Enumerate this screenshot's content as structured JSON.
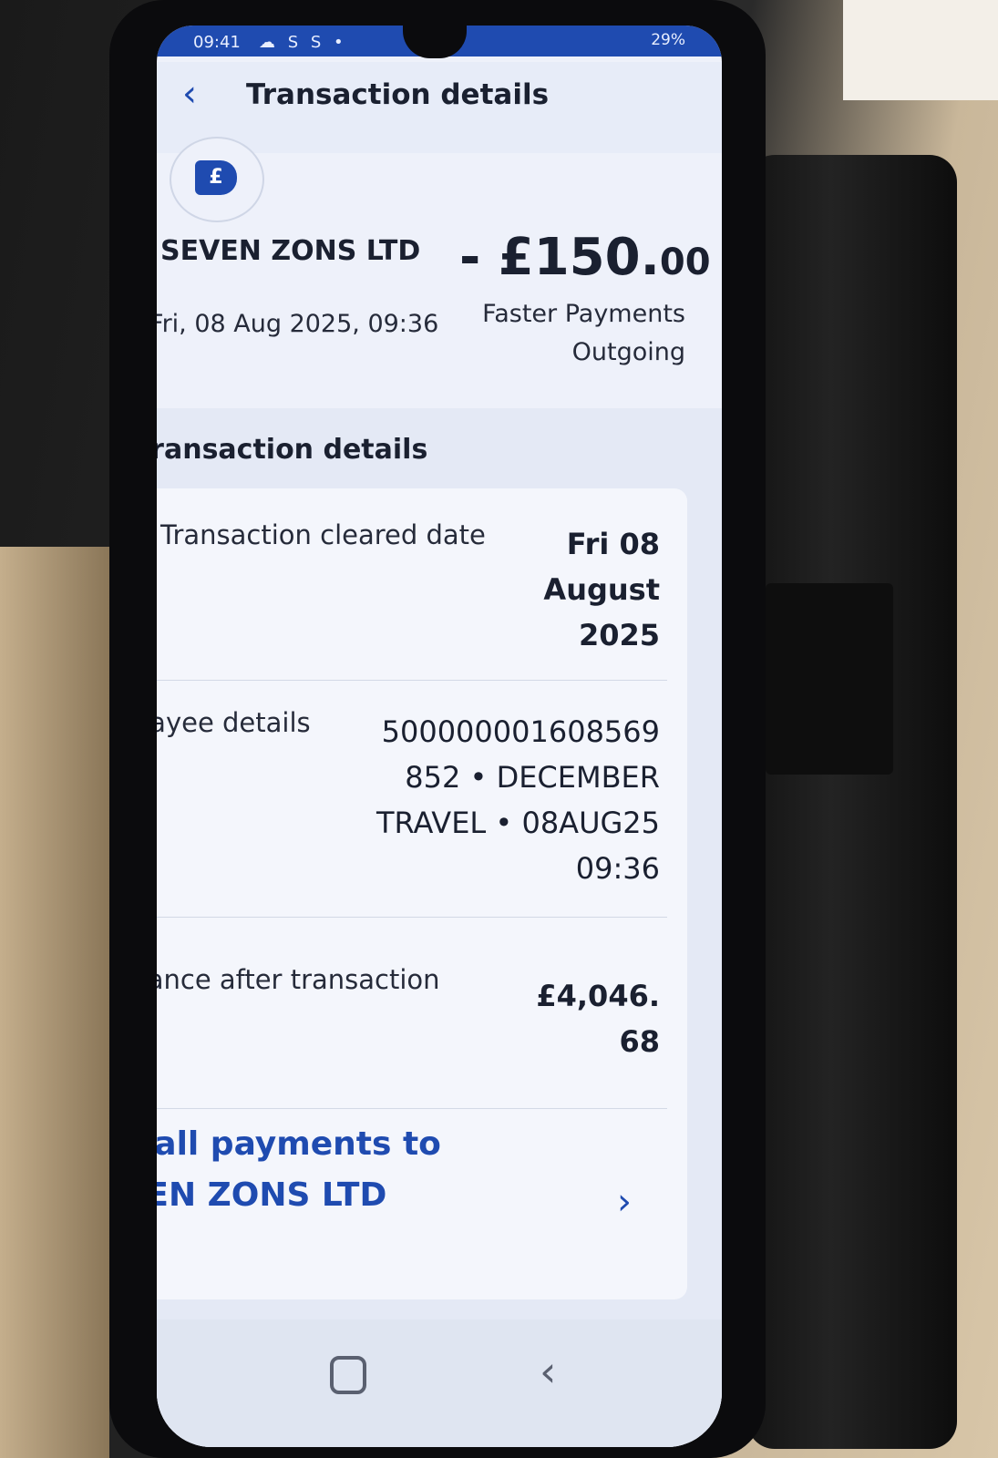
{
  "status_bar": {
    "time": "09:41",
    "left_icons": "☁ S S •",
    "right_text": "29%"
  },
  "header": {
    "title": "Transaction details",
    "back_icon": "chevron-left-icon"
  },
  "transaction": {
    "payee": "SEVEN ZONS LTD",
    "amount_main": "- £150.",
    "amount_pence": "00",
    "datetime": "Fri, 08 Aug 2025, 09:36",
    "payment_type": "Faster Payments",
    "direction": "Outgoing"
  },
  "details": {
    "section_title": "Transaction details",
    "cleared_label": "Transaction cleared date",
    "cleared_value": "Fri 08 August 2025",
    "payee_label": "Payee details",
    "payee_value": "500000001608569 852 • DECEMBER TRAVEL • 08AUG25 09:36",
    "balance_label": "Balance after transaction",
    "balance_value": "£4,046. 68"
  },
  "see_all": {
    "label": "See all payments to SEVEN ZONS LTD"
  },
  "colors": {
    "brand": "#1f4bb0",
    "text": "#1a2030",
    "background": "#eef1fa"
  }
}
